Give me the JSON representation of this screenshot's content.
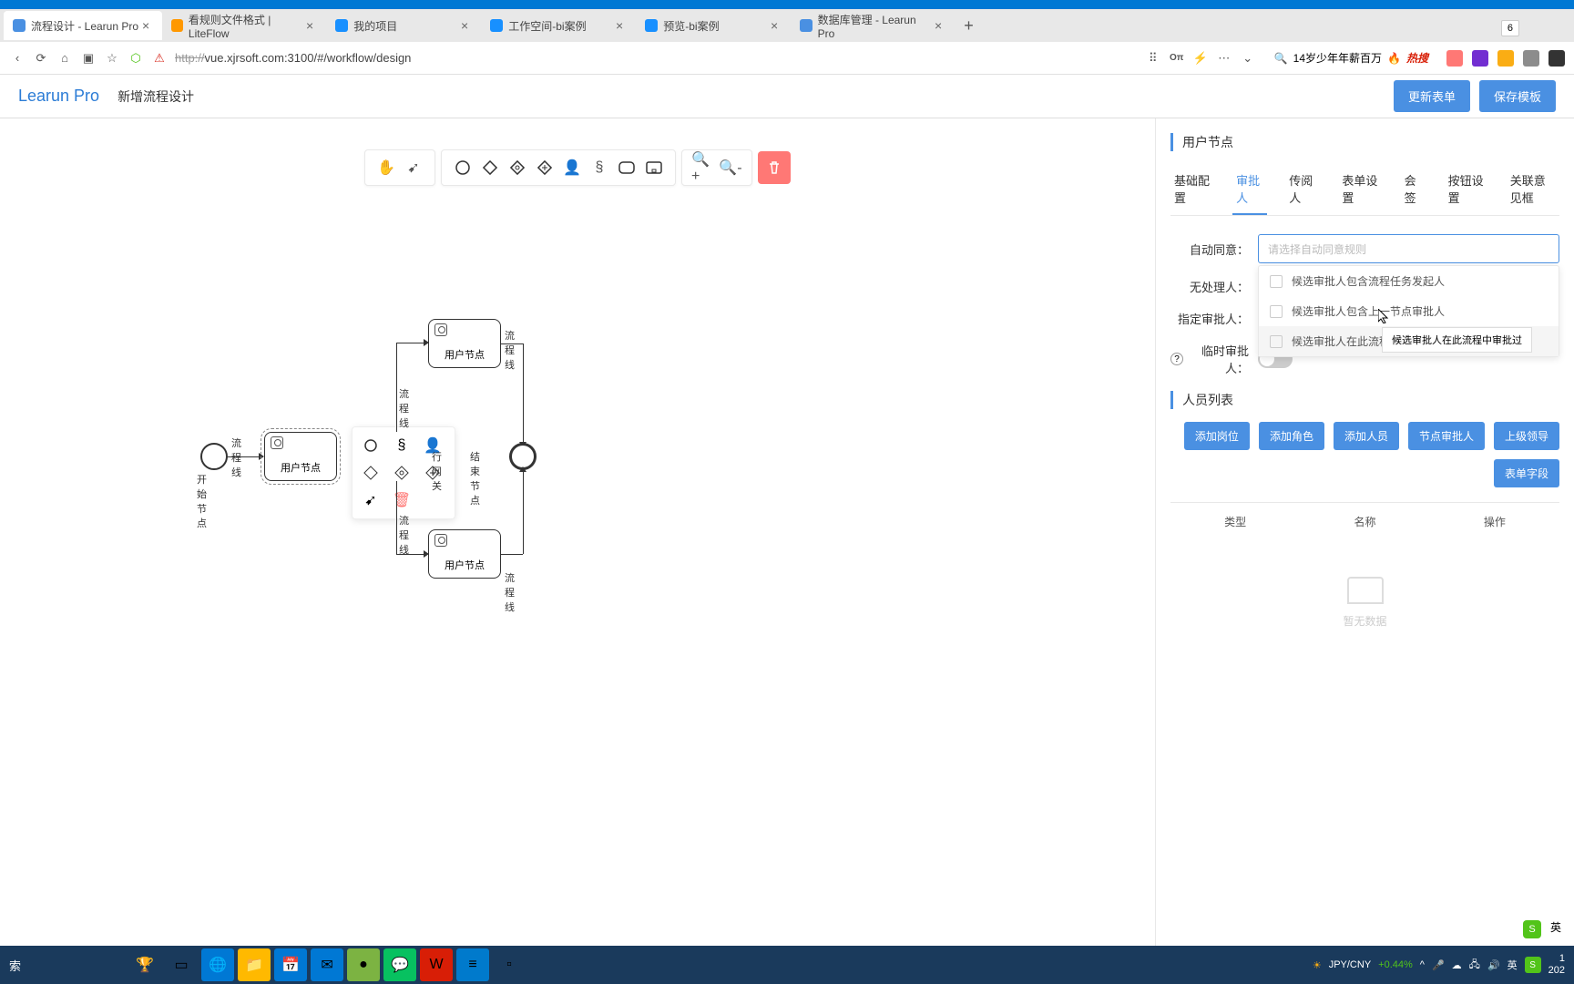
{
  "browser": {
    "tabs": [
      {
        "title": "流程设计 - Learun Pro",
        "icon_color": "#4a90e2"
      },
      {
        "title": "看规则文件格式 | LiteFlow",
        "icon_color": "#ff9800"
      },
      {
        "title": "我的项目",
        "icon_color": "#1890ff"
      },
      {
        "title": "工作空间-bi案例",
        "icon_color": "#1890ff"
      },
      {
        "title": "预览-bi案例",
        "icon_color": "#1890ff"
      },
      {
        "title": "数据库管理 - Learun Pro",
        "icon_color": "#4a90e2"
      }
    ],
    "url_struck": "http://",
    "url_rest": "vue.xjrsoft.com:3100/#/workflow/design",
    "search_placeholder": "14岁少年年薪百万",
    "hot_label": "热搜",
    "float_tag": "6"
  },
  "app": {
    "brand": "Learun Pro",
    "breadcrumb": "新增流程设计",
    "update_btn": "更新表单",
    "save_btn": "保存模板"
  },
  "diagram": {
    "start_label": "开始节点",
    "end_label": "结束节点",
    "user_node": "用户节点",
    "gateway_label": "行网关",
    "edge_label": "流程线"
  },
  "panel": {
    "title": "用户节点",
    "tabs": [
      "基础配置",
      "审批人",
      "传阅人",
      "表单设置",
      "会签",
      "按钮设置",
      "关联意见框"
    ],
    "active_tab": 1,
    "auto_agree": {
      "label": "自动同意：",
      "placeholder": "请选择自动同意规则",
      "options": [
        "候选审批人包含流程任务发起人",
        "候选审批人包含上一节点审批人",
        "候选审批人在此流程中审批过"
      ],
      "tooltip": "候选审批人在此流程中审批过"
    },
    "no_handler": "无处理人：",
    "designated": "指定审批人：",
    "temp": "临时审批人：",
    "list_title": "人员列表",
    "buttons": [
      "添加岗位",
      "添加角色",
      "添加人员",
      "节点审批人",
      "上级领导",
      "表单字段"
    ],
    "table_headers": [
      "类型",
      "名称",
      "操作"
    ],
    "empty": "暂无数据"
  },
  "taskbar": {
    "search": "索",
    "currency_pair": "JPY/CNY",
    "currency_change": "+0.44%",
    "ime": "英",
    "time_suffix": "1",
    "date": "202"
  }
}
